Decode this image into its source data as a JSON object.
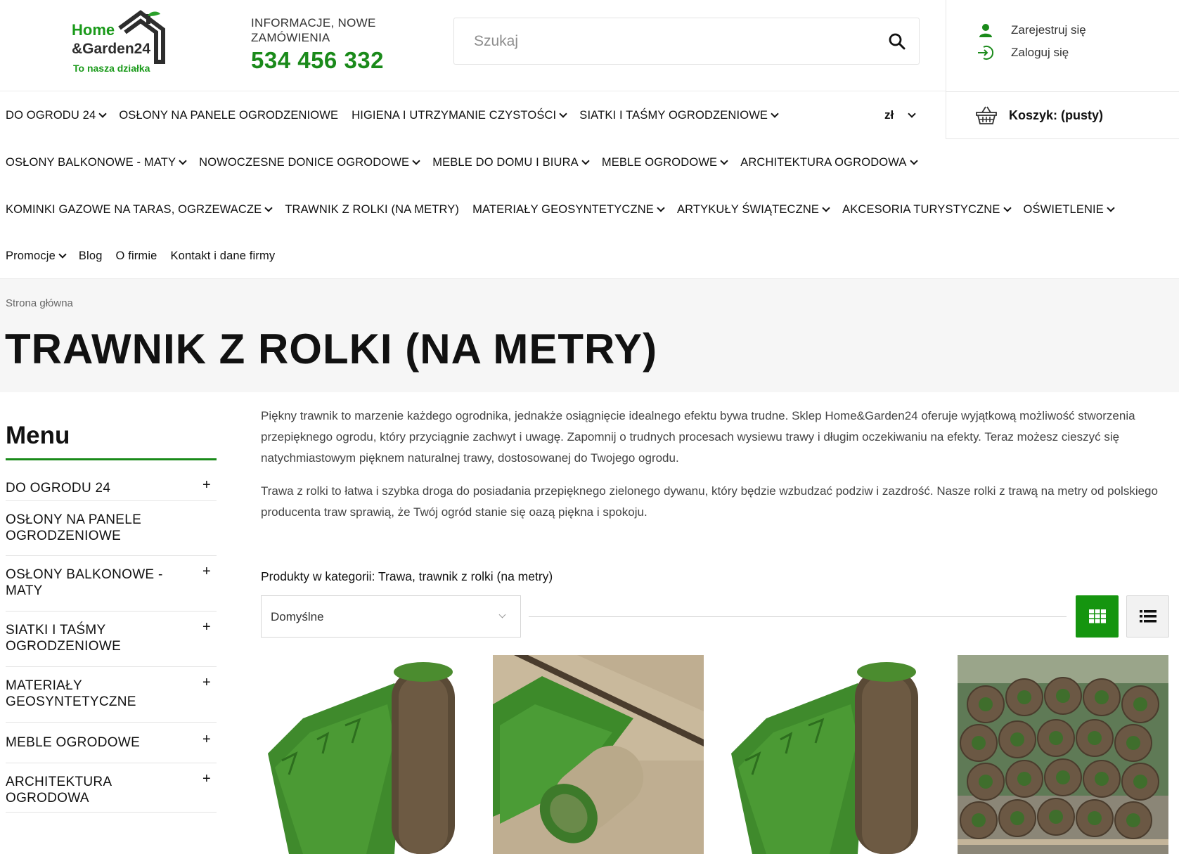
{
  "header": {
    "logo": {
      "line1": "Home",
      "line2": "&Garden24",
      "tagline": "To nasza działka"
    },
    "contact_label": "INFORMACJE, NOWE ZAMÓWIENIA",
    "phone": "534 456 332",
    "search_placeholder": "Szukaj",
    "register": "Zarejestruj się",
    "login": "Zaloguj się",
    "currency": "zł",
    "cart": "Koszyk: (pusty)"
  },
  "nav": {
    "row1": [
      {
        "label": "DO OGRODU 24",
        "dropdown": true
      },
      {
        "label": "OSŁONY NA PANELE OGRODZENIOWE",
        "dropdown": false
      },
      {
        "label": "HIGIENA I UTRZYMANIE CZYSTOŚCI",
        "dropdown": true
      },
      {
        "label": "SIATKI I TAŚMY OGRODZENIOWE",
        "dropdown": true
      }
    ],
    "row2": [
      {
        "label": "OSŁONY BALKONOWE - MATY",
        "dropdown": true
      },
      {
        "label": "NOWOCZESNE DONICE OGRODOWE",
        "dropdown": true
      },
      {
        "label": "MEBLE DO DOMU I BIURA",
        "dropdown": true
      },
      {
        "label": "MEBLE OGRODOWE",
        "dropdown": true
      },
      {
        "label": "ARCHITEKTURA OGRODOWA",
        "dropdown": true
      }
    ],
    "row3": [
      {
        "label": "KOMINKI GAZOWE NA TARAS, OGRZEWACZE",
        "dropdown": true
      },
      {
        "label": "TRAWNIK Z ROLKI (NA METRY)",
        "dropdown": false
      },
      {
        "label": "MATERIAŁY GEOSYNTETYCZNE",
        "dropdown": true
      },
      {
        "label": "ARTYKUŁY ŚWIĄTECZNE",
        "dropdown": true
      },
      {
        "label": "AKCESORIA TURYSTYCZNE",
        "dropdown": true
      },
      {
        "label": "OŚWIETLENIE",
        "dropdown": true
      }
    ],
    "row4": [
      {
        "label": "Promocje",
        "dropdown": true
      },
      {
        "label": "Blog",
        "dropdown": false
      },
      {
        "label": "O firmie",
        "dropdown": false
      },
      {
        "label": "Kontakt i dane firmy",
        "dropdown": false
      }
    ]
  },
  "breadcrumb": "Strona główna",
  "page_title": "TRAWNIK Z ROLKI (NA METRY)",
  "sidebar": {
    "title": "Menu",
    "items": [
      {
        "label": "DO OGRODU 24",
        "expand": "+"
      },
      {
        "label": "OSŁONY NA PANELE OGRODZENIOWE",
        "expand": ""
      },
      {
        "label": "OSŁONY BALKONOWE - MATY",
        "expand": "+"
      },
      {
        "label": "SIATKI I TAŚMY OGRODZENIOWE",
        "expand": "+"
      },
      {
        "label": "MATERIAŁY GEOSYNTETYCZNE",
        "expand": "+"
      },
      {
        "label": "MEBLE OGRODOWE",
        "expand": "+"
      },
      {
        "label": "ARCHITEKTURA OGRODOWA",
        "expand": "+"
      }
    ]
  },
  "description": [
    "Piękny trawnik to marzenie każdego ogrodnika, jednakże osiągnięcie idealnego efektu bywa trudne. Sklep Home&Garden24 oferuje wyjątkową możliwość stworzenia przepięknego ogrodu, który przyciągnie zachwyt i uwagę. Zapomnij o trudnych procesach wysiewu trawy i długim oczekiwaniu na efekty. Teraz możesz cieszyć się natychmiastowym pięknem naturalnej trawy, dostosowanej do Twojego ogrodu.",
    "Trawa z rolki to łatwa i szybka droga do posiadania przepięknego zielonego dywanu, który będzie wzbudzać podziw i zazdrość. Nasze rolki z trawą na metry od polskiego producenta traw sprawią, że Twój ogród stanie się oazą piękna i spokoju."
  ],
  "products_label": "Produkty w kategorii: Trawa, trawnik z rolki (na metry)",
  "sort_value": "Domyślne",
  "colors": {
    "brand_green": "#1a8a1a",
    "grid_button": "#15950f"
  }
}
